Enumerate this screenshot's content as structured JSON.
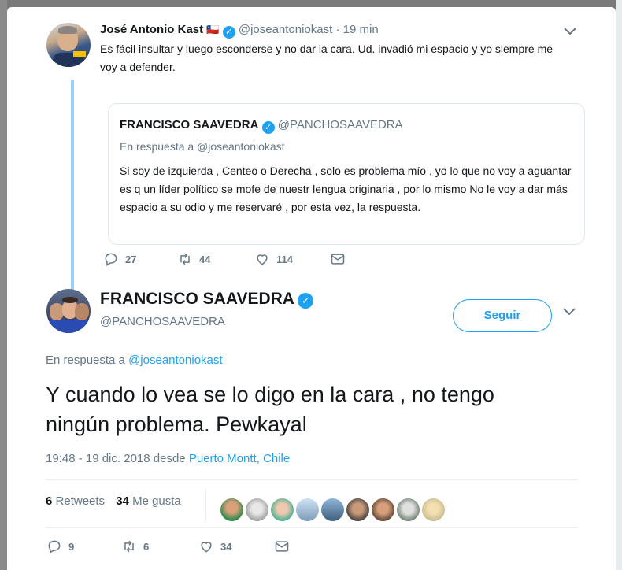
{
  "parent_tweet": {
    "author_name": "José Antonio Kast",
    "flag": "🇨🇱",
    "handle": "@joseantoniokast",
    "separator": "·",
    "time_ago": "19 min",
    "text": "Es fácil insultar y luego esconderse y no dar la cara. Ud. invadió mi espacio y yo siempre me voy a defender.",
    "replies": "27",
    "retweets": "44",
    "likes": "114"
  },
  "quoted_tweet": {
    "author_name": "FRANCISCO SAAVEDRA",
    "handle": "@PANCHOSAAVEDRA",
    "reply_prefix": "En respuesta a",
    "reply_to": "@joseantoniokast",
    "text": "Si soy de izquierda , Centeo o Derecha , solo es problema mío , yo lo que no voy a aguantar es q un líder político se mofe de nuestr lengua originaria , por lo mismo No le voy a dar más espacio a su odio y me reservaré , por esta vez, la respuesta."
  },
  "main_tweet": {
    "author_name": "FRANCISCO SAAVEDRA",
    "handle": "@PANCHOSAAVEDRA",
    "follow_label": "Seguir",
    "reply_prefix": "En respuesta a",
    "reply_to": "@joseantoniokast",
    "text": "Y cuando lo vea se lo digo en la cara , no tengo ningún problema. Pewkayal",
    "timestamp": "19:48 - 19 dic. 2018 desde",
    "location": "Puerto Montt, Chile",
    "retweets_count": "6",
    "retweets_label": "Retweets",
    "likes_count": "34",
    "likes_label": "Me gusta",
    "replies": "9",
    "retweets": "6",
    "likes": "34"
  },
  "colors": {
    "accent": "#1da1f2",
    "thread_line": "#9cd1f6",
    "secondary_text": "#657786"
  }
}
